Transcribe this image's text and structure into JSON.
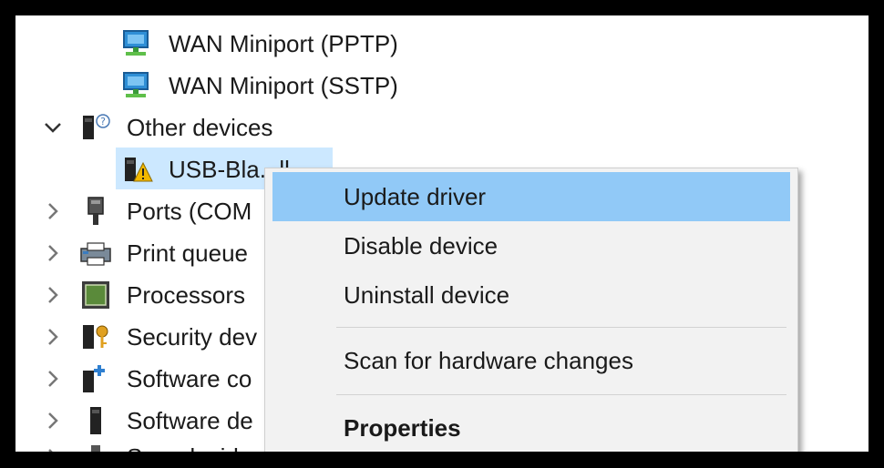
{
  "tree": {
    "items": [
      {
        "label": "WAN Miniport (PPTP)",
        "icon": "network-adapter-icon",
        "expander": "none"
      },
      {
        "label": "WAN Miniport (SSTP)",
        "icon": "network-adapter-icon",
        "expander": "none"
      },
      {
        "label": "Other devices",
        "icon": "unknown-device-icon",
        "expander": "expanded"
      },
      {
        "label": "USB-Bla...ll",
        "icon": "warning-device-icon",
        "expander": "none"
      },
      {
        "label": "Ports (COM",
        "icon": "port-icon",
        "expander": "collapsed"
      },
      {
        "label": "Print queue",
        "icon": "printer-icon",
        "expander": "collapsed"
      },
      {
        "label": "Processors",
        "icon": "processor-icon",
        "expander": "collapsed"
      },
      {
        "label": "Security dev",
        "icon": "security-device-icon",
        "expander": "collapsed"
      },
      {
        "label": "Software co",
        "icon": "software-component-icon",
        "expander": "collapsed"
      },
      {
        "label": "Software de",
        "icon": "software-device-icon",
        "expander": "collapsed"
      },
      {
        "label": "Sound, vide",
        "icon": "sound-icon",
        "expander": "collapsed"
      }
    ]
  },
  "context_menu": {
    "items": [
      {
        "label": "Update driver",
        "highlighted": true
      },
      {
        "label": "Disable device"
      },
      {
        "label": "Uninstall device"
      },
      {
        "label": "Scan for hardware changes"
      },
      {
        "label": "Properties",
        "bold": true
      }
    ]
  },
  "colors": {
    "frame": "#000000",
    "selection": "#cce8ff",
    "menu_highlight": "#91c9f7",
    "menu_background": "#f2f2f2"
  }
}
